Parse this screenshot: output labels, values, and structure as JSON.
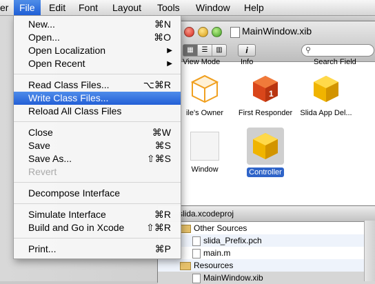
{
  "menubar": {
    "items": [
      "er",
      "File",
      "Edit",
      "Font",
      "Layout",
      "Tools",
      "Window",
      "Help"
    ]
  },
  "file_menu": {
    "new": {
      "label": "New...",
      "shortcut": "⌘N"
    },
    "open": {
      "label": "Open...",
      "shortcut": "⌘O"
    },
    "open_localization": {
      "label": "Open Localization"
    },
    "open_recent": {
      "label": "Open Recent"
    },
    "read_class_files": {
      "label": "Read Class Files...",
      "shortcut": "⌥⌘R"
    },
    "write_class_files": {
      "label": "Write Class Files..."
    },
    "reload_all_class_files": {
      "label": "Reload All Class Files"
    },
    "close": {
      "label": "Close",
      "shortcut": "⌘W"
    },
    "save": {
      "label": "Save",
      "shortcut": "⌘S"
    },
    "save_as": {
      "label": "Save As...",
      "shortcut": "⇧⌘S"
    },
    "revert": {
      "label": "Revert"
    },
    "decompose_interface": {
      "label": "Decompose Interface"
    },
    "simulate_interface": {
      "label": "Simulate Interface",
      "shortcut": "⌘R"
    },
    "build_and_go": {
      "label": "Build and Go in Xcode",
      "shortcut": "⇧⌘R"
    },
    "print": {
      "label": "Print...",
      "shortcut": "⌘P"
    }
  },
  "doc_window": {
    "title": "MainWindow.xib",
    "toolbar": {
      "view_mode_label": "View Mode",
      "info_label": "Info",
      "info_glyph": "i",
      "search_label": "Search Field"
    },
    "objects": [
      {
        "name": "ile's Owner"
      },
      {
        "name": "First Responder"
      },
      {
        "name": "Slida App Del..."
      },
      {
        "name": "Window"
      },
      {
        "name": "Controller"
      }
    ]
  },
  "project_window": {
    "title": "slida.xcodeproj",
    "rows": [
      "Other Sources",
      "slida_Prefix.pch",
      "main.m",
      "Resources",
      "MainWindow.xib"
    ]
  }
}
